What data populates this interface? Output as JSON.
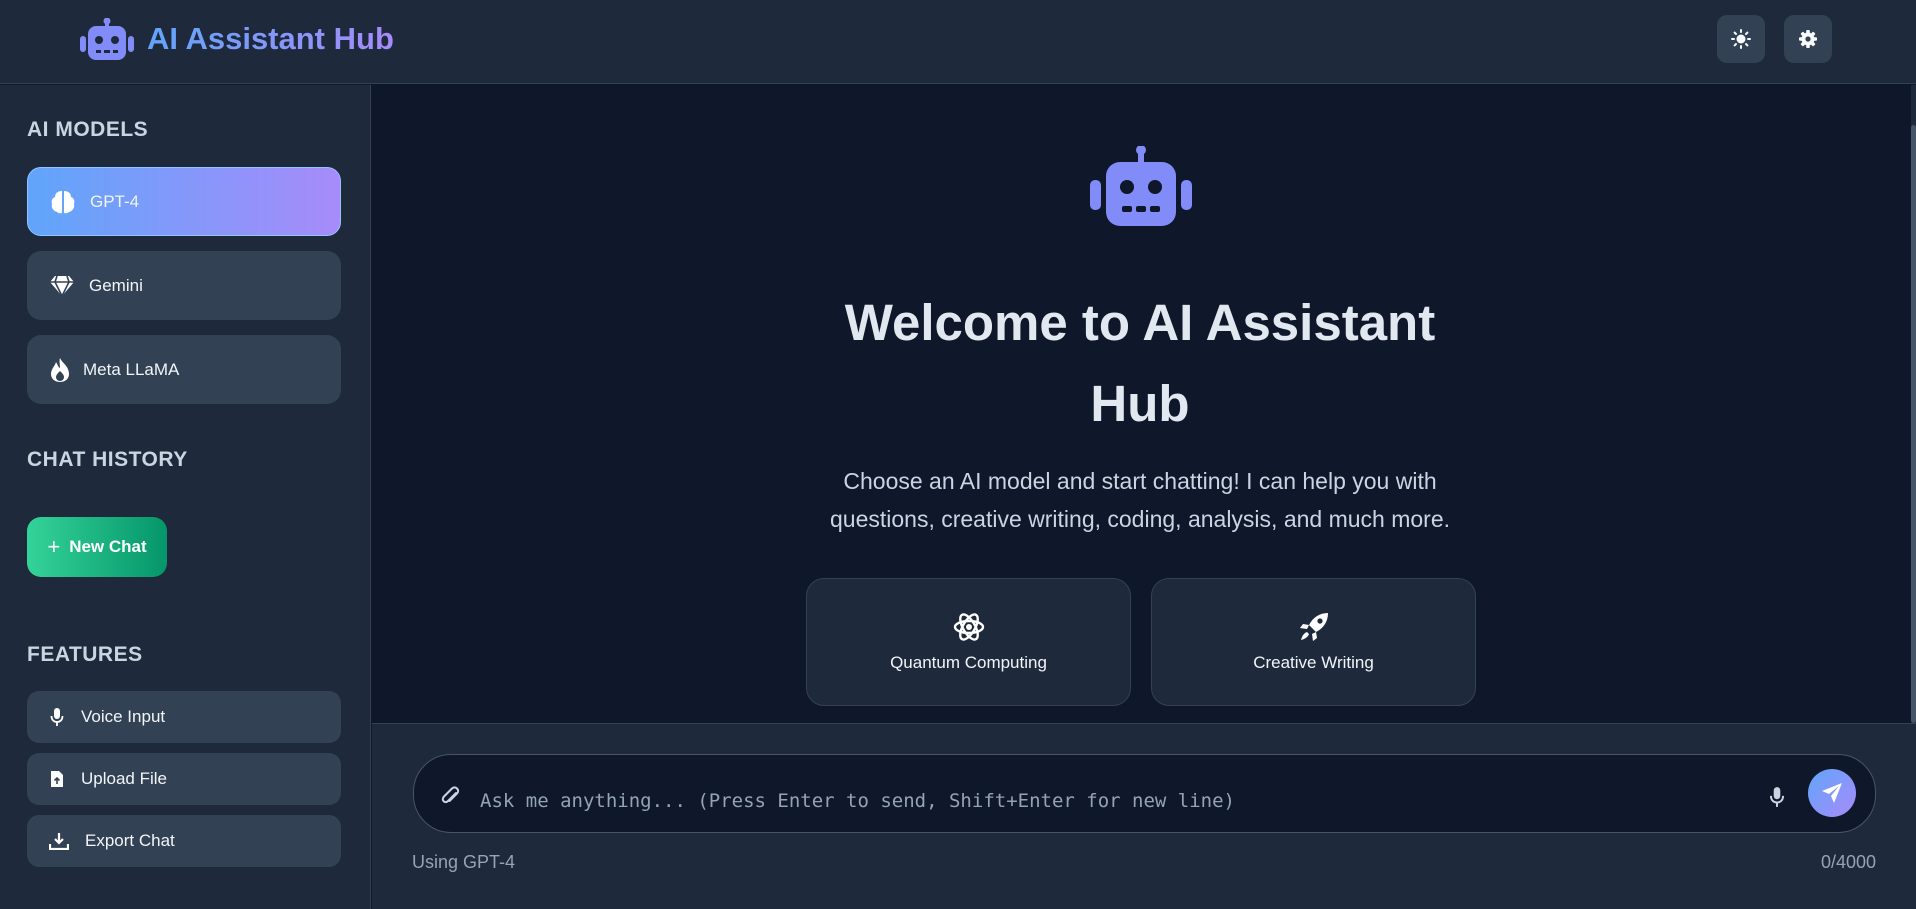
{
  "header": {
    "title": "AI Assistant Hub",
    "logo_icon": "robot-icon",
    "theme_icon": "sun-icon",
    "settings_icon": "gear-icon"
  },
  "sidebar": {
    "models_title": "AI MODELS",
    "models": [
      {
        "label": "GPT-4",
        "icon": "brain-icon",
        "active": true
      },
      {
        "label": "Gemini",
        "icon": "gem-icon",
        "active": false
      },
      {
        "label": "Meta LLaMA",
        "icon": "fire-icon",
        "active": false
      }
    ],
    "history_title": "CHAT HISTORY",
    "new_chat_label": "New Chat",
    "features_title": "FEATURES",
    "features": [
      {
        "label": "Voice Input",
        "icon": "microphone-icon"
      },
      {
        "label": "Upload File",
        "icon": "file-upload-icon"
      },
      {
        "label": "Export Chat",
        "icon": "download-icon"
      }
    ]
  },
  "main": {
    "welcome_line1": "Welcome to AI Assistant",
    "welcome_line2": "Hub",
    "subtitle_line1": "Choose an AI model and start chatting! I can help you with",
    "subtitle_line2": "questions, creative writing, coding, analysis, and much more.",
    "cards": [
      {
        "label": "Quantum Computing",
        "icon": "atom-icon"
      },
      {
        "label": "Creative Writing",
        "icon": "rocket-icon"
      }
    ]
  },
  "input": {
    "placeholder": "Ask me anything... (Press Enter to send, Shift+Enter for new line)",
    "value": "",
    "status_model": "Using GPT-4",
    "char_count": "0/4000"
  },
  "colors": {
    "accent_start": "#60a5fa",
    "accent_end": "#a78bfa",
    "new_chat_start": "#34d399",
    "new_chat_end": "#059669",
    "panel": "#1e293b",
    "background": "#0f172a"
  }
}
